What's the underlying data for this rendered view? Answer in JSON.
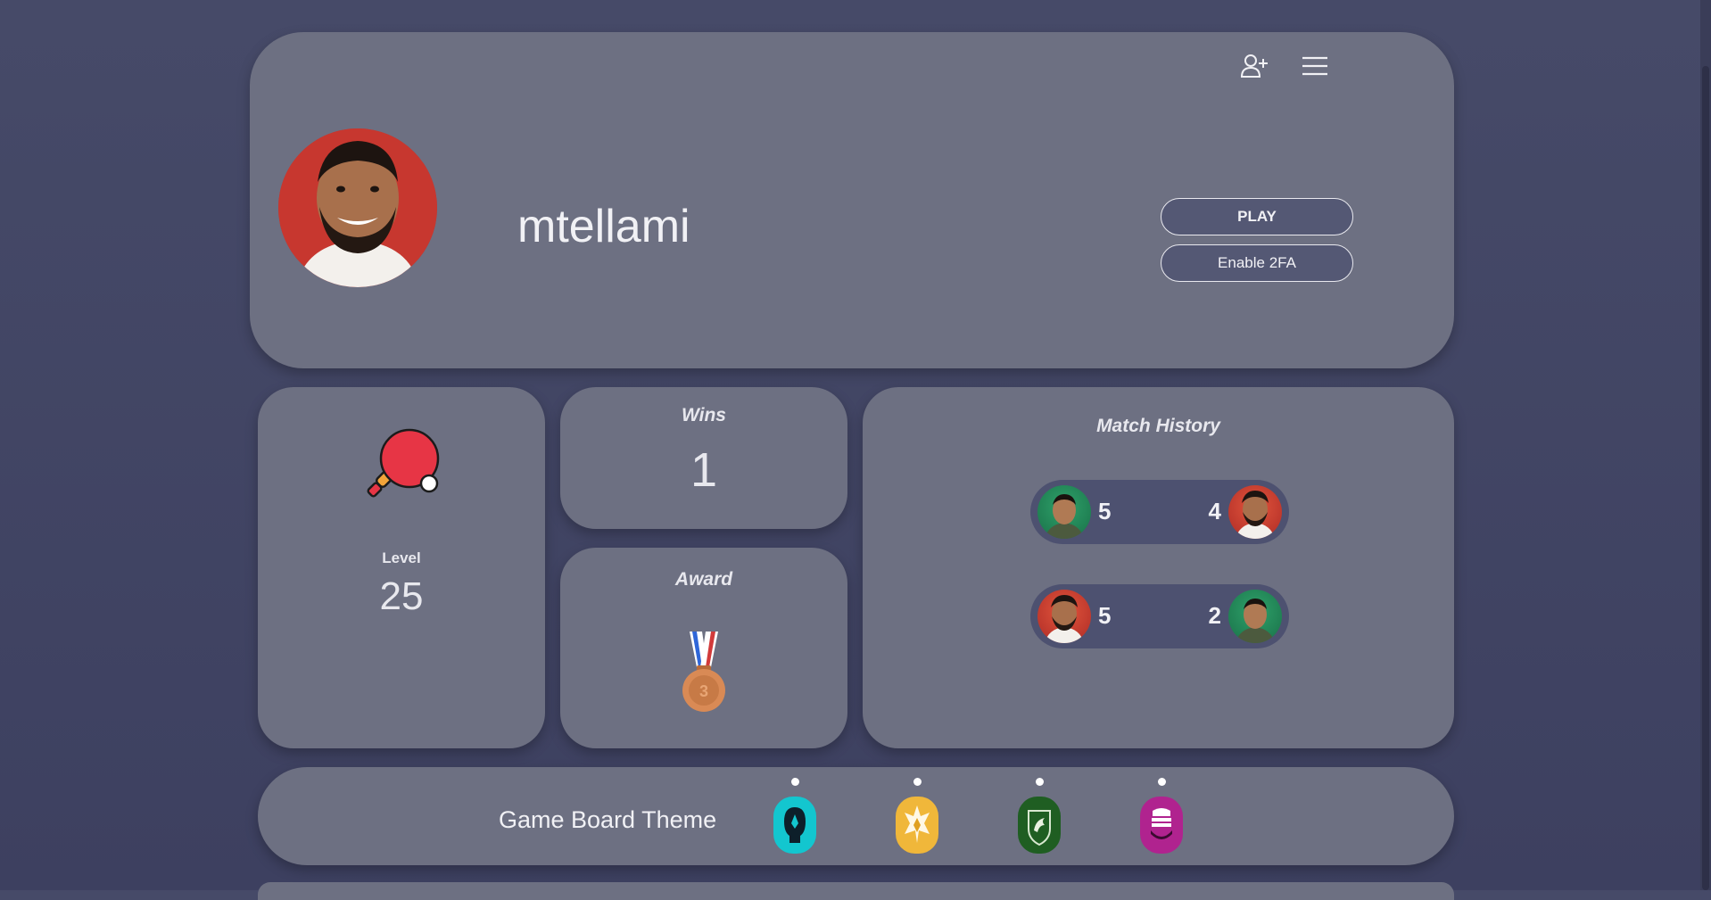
{
  "profile": {
    "username": "mtellami",
    "play_label": "PLAY",
    "twofa_label": "Enable 2FA"
  },
  "stats": {
    "level_label": "Level",
    "level_value": "25",
    "wins_label": "Wins",
    "wins_value": "1",
    "award_label": "Award"
  },
  "history": {
    "title": "Match History",
    "matches": [
      {
        "left_score": "5",
        "right_score": "4"
      },
      {
        "left_score": "5",
        "right_score": "2"
      }
    ]
  },
  "themes": {
    "label": "Game Board Theme",
    "items": [
      {
        "name": "cyan-theme",
        "color": "#13c6cf"
      },
      {
        "name": "yellow-theme",
        "color": "#f0b73a"
      },
      {
        "name": "green-theme",
        "color": "#1f5e22"
      },
      {
        "name": "magenta-theme",
        "color": "#b0238f"
      }
    ]
  },
  "colors": {
    "background": "#464a68",
    "card": "#6d7082",
    "button_bg": "#545874"
  },
  "icons": [
    "add-user-icon",
    "menu-icon",
    "paddle-icon",
    "medal-icon"
  ]
}
